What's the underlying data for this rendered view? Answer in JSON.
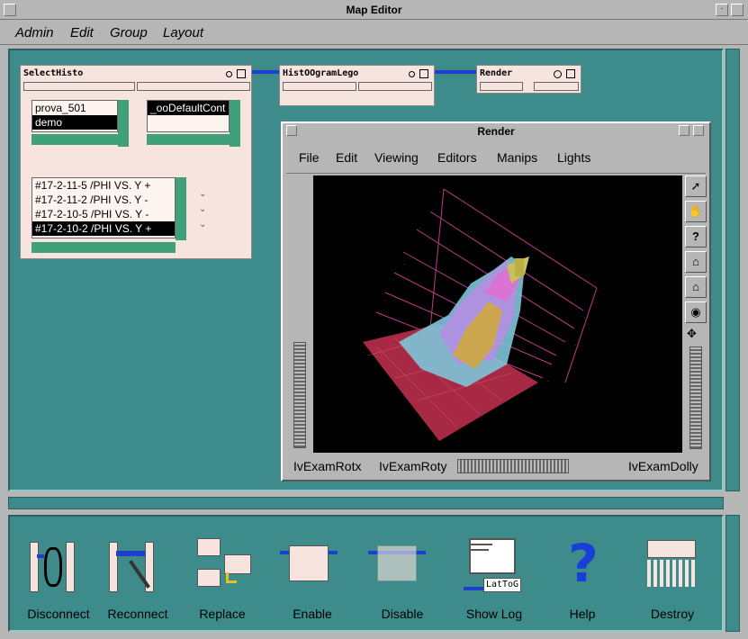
{
  "window": {
    "title": "Map Editor"
  },
  "menu": [
    "Admin",
    "Edit",
    "Group",
    "Layout"
  ],
  "nodes": {
    "select_histo": {
      "title": "SelectHisto",
      "list1": [
        "prova_501",
        "demo"
      ],
      "list2": [
        "_ooDefaultCont"
      ],
      "histos": [
        "#17-2-11-5 /PHI VS. Y",
        "#17-2-11-2 /PHI VS. Y",
        "#17-2-10-5 /PHI VS. Y",
        "#17-2-10-2 /PHI VS. Y"
      ],
      "histo_marks": [
        "+",
        "-",
        "-",
        "+"
      ]
    },
    "histogram_lego": {
      "title": "HistOOgramLego"
    },
    "render": {
      "title": "Render"
    }
  },
  "render_window": {
    "title": "Render",
    "menu": [
      "File",
      "Edit",
      "Viewing",
      "Editors",
      "Manips",
      "Lights"
    ],
    "side_tools": [
      "arrow-icon",
      "hand-icon",
      "question-icon",
      "home-icon",
      "set-home-icon",
      "eye-icon",
      "seek-icon"
    ],
    "side_glyphs": [
      "➚",
      "✋",
      "?",
      "⌂",
      "⌂",
      "◉",
      "✥"
    ],
    "labels": {
      "rotx": "IvExamRotx",
      "roty": "IvExamRoty",
      "dolly": "IvExamDolly"
    }
  },
  "toolbar": [
    {
      "label": "Disconnect",
      "icon": "disconnect-icon"
    },
    {
      "label": "Reconnect",
      "icon": "reconnect-icon"
    },
    {
      "label": "Replace",
      "icon": "replace-icon"
    },
    {
      "label": "Enable",
      "icon": "enable-icon"
    },
    {
      "label": "Disable",
      "icon": "disable-icon"
    },
    {
      "label": "Show Log",
      "icon": "show-log-icon",
      "sub": "LatToG"
    },
    {
      "label": "Help",
      "icon": "help-icon"
    },
    {
      "label": "Destroy",
      "icon": "destroy-icon"
    }
  ],
  "colors": {
    "canvas": "#3d8b8b",
    "node": "#f8e4de",
    "wire": "#1f3fd0"
  }
}
